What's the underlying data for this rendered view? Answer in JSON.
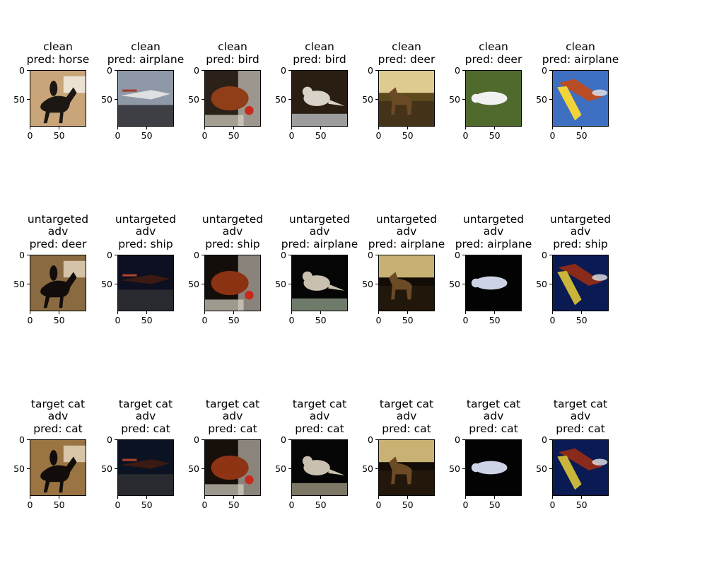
{
  "figure": {
    "rows": [
      {
        "name": "clean",
        "panels": [
          {
            "title": [
              "clean",
              "pred: horse"
            ],
            "image": "horse-rider-photo",
            "colors": {
              "bg": "#c9a57a",
              "subject": "#1c1713",
              "accent": "#f4f1ea"
            }
          },
          {
            "title": [
              "clean",
              "pred: airplane"
            ],
            "image": "airplane-on-tarmac-photo",
            "colors": {
              "bg": "#8e98a6",
              "subject": "#dfe0e2",
              "accent": "#a33b30"
            }
          },
          {
            "title": [
              "clean",
              "pred: bird"
            ],
            "image": "chicken-photo",
            "colors": {
              "bg": "#2b2119",
              "subject": "#8f3e17",
              "accent": "#e8e4dc"
            }
          },
          {
            "title": [
              "clean",
              "pred: bird"
            ],
            "image": "sparrow-on-rail-photo",
            "colors": {
              "bg": "#2a1d12",
              "subject": "#d8d2c8",
              "accent": "#9d9d9d"
            }
          },
          {
            "title": [
              "clean",
              "pred: deer"
            ],
            "image": "deer-in-field-photo",
            "colors": {
              "bg": "#5c4a1d",
              "subject": "#3b2a18",
              "accent": "#f3e2a4"
            }
          },
          {
            "title": [
              "clean",
              "pred: deer"
            ],
            "image": "white-deer-on-grass-photo",
            "colors": {
              "bg": "#4f6a2c",
              "subject": "#f1f1f1",
              "accent": "#3c5522"
            }
          },
          {
            "title": [
              "clean",
              "pred: airplane"
            ],
            "image": "propeller-plane-in-sky-photo",
            "colors": {
              "bg": "#3f6fc1",
              "subject": "#b84c24",
              "accent": "#f2d43a"
            }
          }
        ]
      },
      {
        "name": "untargeted",
        "panels": [
          {
            "title": [
              "untargeted",
              "adv",
              "pred: deer"
            ],
            "image": "adversarial-horse-photo",
            "colors": {
              "bg": "#8a6a40",
              "subject": "#120d0a",
              "accent": "#e7d9c2"
            }
          },
          {
            "title": [
              "untargeted",
              "adv",
              "pred: ship"
            ],
            "image": "adversarial-airplane-photo",
            "colors": {
              "bg": "#0c1020",
              "subject": "#3a1a12",
              "accent": "#b04030"
            }
          },
          {
            "title": [
              "untargeted",
              "adv",
              "pred: ship"
            ],
            "image": "adversarial-chicken-photo",
            "colors": {
              "bg": "#140e0a",
              "subject": "#8a3212",
              "accent": "#d9d2c6"
            }
          },
          {
            "title": [
              "untargeted",
              "adv",
              "pred: airplane"
            ],
            "image": "adversarial-bird-photo",
            "colors": {
              "bg": "#050505",
              "subject": "#c9c0b0",
              "accent": "#6e7a6a"
            }
          },
          {
            "title": [
              "untargeted",
              "adv",
              "pred: airplane"
            ],
            "image": "adversarial-deer-photo",
            "colors": {
              "bg": "#120c06",
              "subject": "#2a1d0e",
              "accent": "#e8cf86"
            }
          },
          {
            "title": [
              "untargeted",
              "adv",
              "pred: airplane"
            ],
            "image": "adversarial-white-deer-photo",
            "colors": {
              "bg": "#030303",
              "subject": "#cdd3e6",
              "accent": "#1a1f14"
            }
          },
          {
            "title": [
              "untargeted",
              "adv",
              "pred: ship"
            ],
            "image": "adversarial-plane-photo",
            "colors": {
              "bg": "#0a1a52",
              "subject": "#8a2a1a",
              "accent": "#c9b53a"
            }
          }
        ]
      },
      {
        "name": "targeted",
        "panels": [
          {
            "title": [
              "target cat",
              "adv",
              "pred: cat"
            ],
            "image": "targeted-horse-photo",
            "colors": {
              "bg": "#9a7442",
              "subject": "#120d0a",
              "accent": "#e7d9c2"
            }
          },
          {
            "title": [
              "target cat",
              "adv",
              "pred: cat"
            ],
            "image": "targeted-airplane-photo",
            "colors": {
              "bg": "#0b1322",
              "subject": "#3a1a12",
              "accent": "#b04030"
            }
          },
          {
            "title": [
              "target cat",
              "adv",
              "pred: cat"
            ],
            "image": "targeted-chicken-photo",
            "colors": {
              "bg": "#160f0a",
              "subject": "#8e3414",
              "accent": "#d9d2c6"
            }
          },
          {
            "title": [
              "target cat",
              "adv",
              "pred: cat"
            ],
            "image": "targeted-bird-photo",
            "colors": {
              "bg": "#050505",
              "subject": "#c9c0b0",
              "accent": "#7d7766"
            }
          },
          {
            "title": [
              "target cat",
              "adv",
              "pred: cat"
            ],
            "image": "targeted-deer-photo",
            "colors": {
              "bg": "#140c06",
              "subject": "#2a1d0e",
              "accent": "#e8cf86"
            }
          },
          {
            "title": [
              "target cat",
              "adv",
              "pred: cat"
            ],
            "image": "targeted-white-deer-photo",
            "colors": {
              "bg": "#030303",
              "subject": "#cdd3e6",
              "accent": "#1a1f14"
            }
          },
          {
            "title": [
              "target cat",
              "adv",
              "pred: cat"
            ],
            "image": "targeted-plane-photo",
            "colors": {
              "bg": "#0a1a52",
              "subject": "#8a2a1a",
              "accent": "#c9b53a"
            }
          }
        ]
      }
    ],
    "axes": {
      "xticks": [
        "0",
        "50"
      ],
      "yticks": [
        "0",
        "50"
      ]
    }
  }
}
